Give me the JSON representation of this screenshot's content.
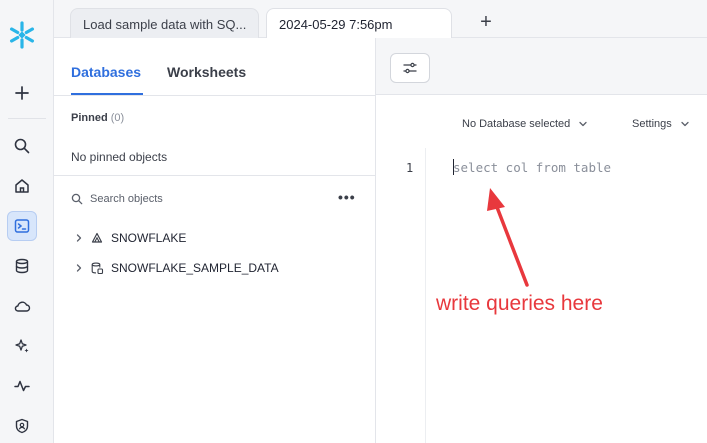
{
  "tabs": [
    {
      "label": "Load sample data with SQ..."
    },
    {
      "label": "2024-05-29 7:56pm"
    }
  ],
  "new_tab_label": "+",
  "rail": {
    "items": [
      "add",
      "search",
      "home",
      "worksheets",
      "data",
      "cloud",
      "ai",
      "activity",
      "admin"
    ],
    "active": "worksheets"
  },
  "panel": {
    "tabs": [
      {
        "label": "Databases"
      },
      {
        "label": "Worksheets"
      }
    ],
    "pinned_label": "Pinned",
    "pinned_count": "(0)",
    "no_pinned_text": "No pinned objects",
    "search_placeholder": "Search objects",
    "more_label": "•••",
    "databases": [
      {
        "name": "SNOWFLAKE",
        "icon": "shared-database-icon"
      },
      {
        "name": "SNOWFLAKE_SAMPLE_DATA",
        "icon": "sample-database-icon"
      }
    ]
  },
  "editor": {
    "database_selector": "No Database selected",
    "settings_label": "Settings",
    "line_number": "1",
    "placeholder_code": "select col from table"
  },
  "annotation": {
    "text": "write queries here",
    "color": "#e8383d"
  },
  "colors": {
    "accent": "#2f6fde",
    "snowflake_blue": "#29b5e8"
  }
}
